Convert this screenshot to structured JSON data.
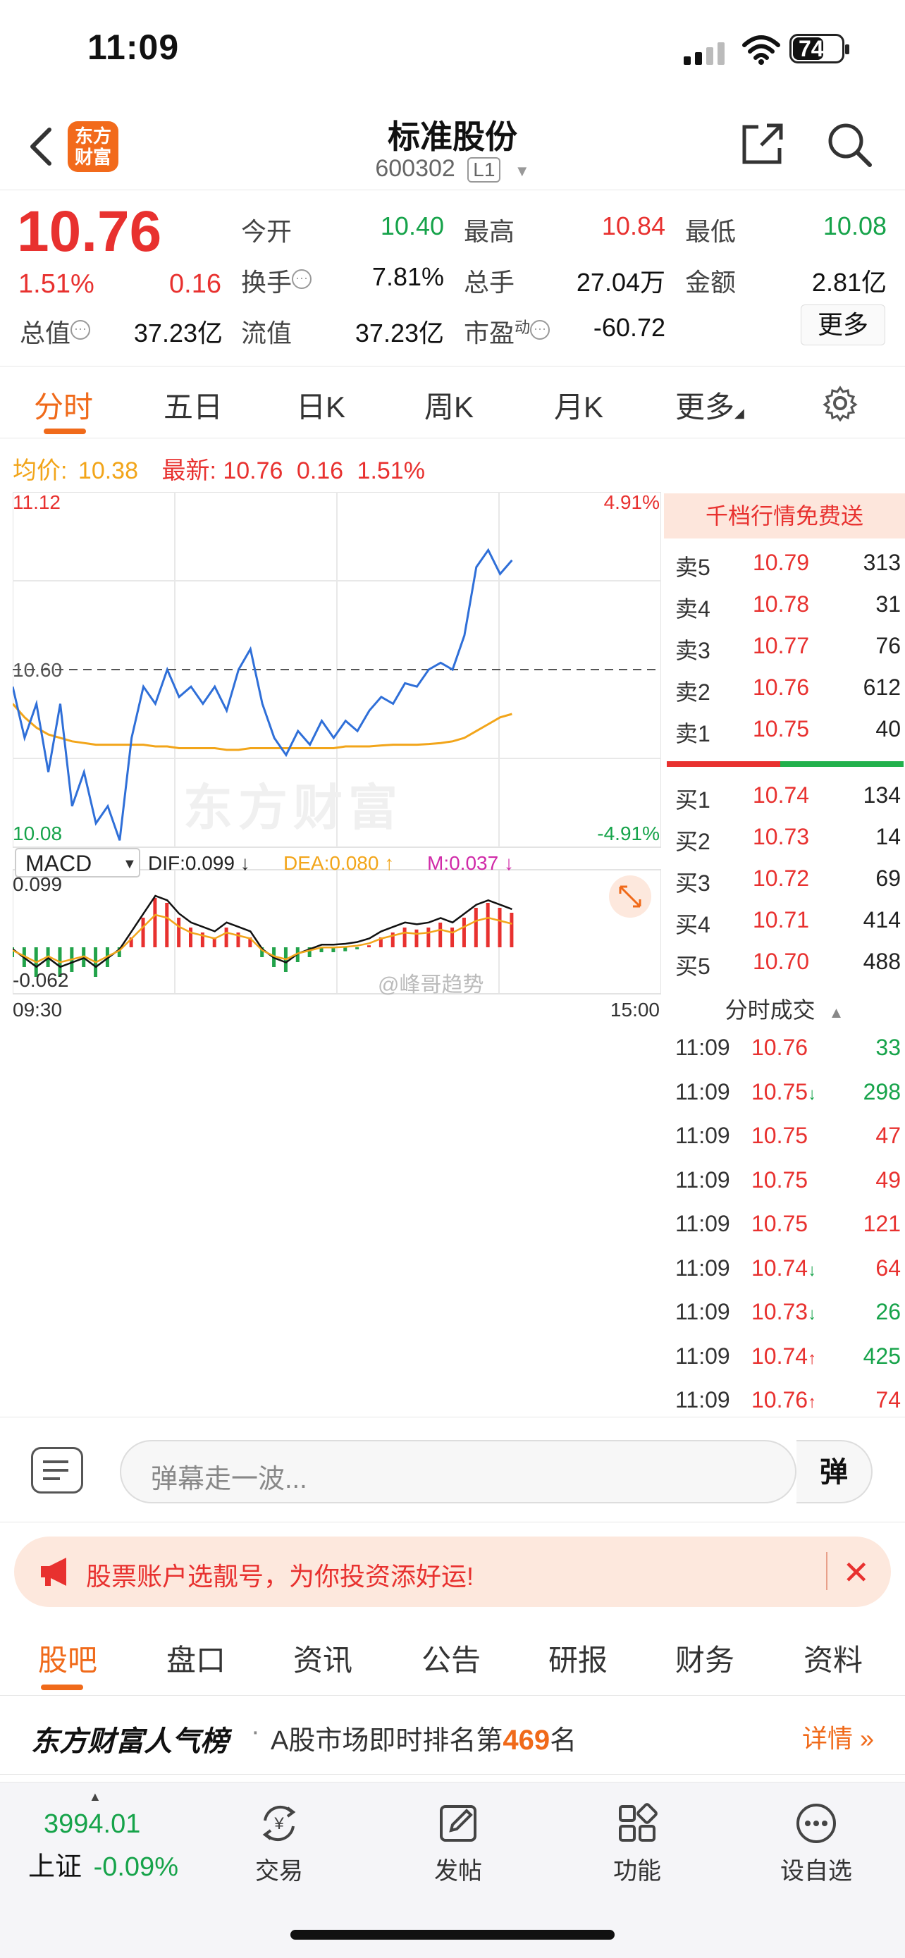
{
  "status": {
    "time": "11:09",
    "battery": "74"
  },
  "header": {
    "title": "标准股份",
    "code": "600302",
    "level": "L1",
    "logo_text": "东方\n财富"
  },
  "quote": {
    "price": "10.76",
    "pct": "1.51%",
    "chg": "0.16",
    "items": [
      {
        "label": "今开",
        "value": "10.40",
        "color": "#16a34a"
      },
      {
        "label": "最高",
        "value": "10.84",
        "color": "#e8312f"
      },
      {
        "label": "最低",
        "value": "10.08",
        "color": "#16a34a"
      },
      {
        "label": "换手",
        "value": "7.81%",
        "color": "#111"
      },
      {
        "label": "总手",
        "value": "27.04万",
        "color": "#111"
      },
      {
        "label": "金额",
        "value": "2.81亿",
        "color": "#111"
      },
      {
        "label": "总值",
        "value": "37.23亿",
        "color": "#111"
      },
      {
        "label": "流值",
        "value": "37.23亿",
        "color": "#111"
      },
      {
        "label": "市盈",
        "value": "-60.72",
        "color": "#111"
      }
    ],
    "dynamic_sup": "动",
    "more": "更多"
  },
  "tabs": [
    "分时",
    "五日",
    "日K",
    "周K",
    "月K",
    "更多"
  ],
  "avg": {
    "label": "均价:",
    "value": "10.38",
    "latest_label": "最新:",
    "latest": "10.76",
    "chg": "0.16",
    "pct": "1.51%"
  },
  "chart": {
    "ymax": "11.12",
    "ymid": "10.60",
    "ymin": "10.08",
    "pmax": "4.91%",
    "pmin": "-4.91%",
    "macd_label": "MACD",
    "dif": "DIF:0.099 ↓",
    "dea": "DEA:0.080 ↑",
    "m": "M:0.037 ↓",
    "macd_top": "0.099",
    "macd_bot": "-0.062",
    "t_start": "09:30",
    "t_end": "15:00",
    "watermark": "东方财富",
    "weibo": "@峰哥趋势"
  },
  "chart_data": {
    "type": "line",
    "price_axis": [
      10.08,
      11.12
    ],
    "price": [
      10.55,
      10.4,
      10.5,
      10.3,
      10.5,
      10.2,
      10.3,
      10.15,
      10.2,
      10.1,
      10.4,
      10.55,
      10.5,
      10.6,
      10.52,
      10.55,
      10.5,
      10.55,
      10.48,
      10.6,
      10.66,
      10.5,
      10.4,
      10.35,
      10.42,
      10.38,
      10.45,
      10.4,
      10.45,
      10.42,
      10.48,
      10.52,
      10.5,
      10.56,
      10.55,
      10.6,
      10.62,
      10.6,
      10.7,
      10.9,
      10.95,
      10.88,
      10.92
    ],
    "avg": [
      10.5,
      10.46,
      10.43,
      10.41,
      10.4,
      10.39,
      10.385,
      10.38,
      10.38,
      10.38,
      10.38,
      10.38,
      10.375,
      10.375,
      10.37,
      10.37,
      10.37,
      10.37,
      10.365,
      10.365,
      10.37,
      10.37,
      10.37,
      10.37,
      10.37,
      10.37,
      10.37,
      10.37,
      10.375,
      10.375,
      10.375,
      10.378,
      10.38,
      10.38,
      10.38,
      10.382,
      10.385,
      10.39,
      10.4,
      10.42,
      10.44,
      10.46,
      10.47
    ],
    "macd_bars": [
      -0.01,
      -0.02,
      -0.03,
      -0.02,
      -0.03,
      -0.025,
      -0.02,
      -0.03,
      -0.02,
      -0.01,
      0.01,
      0.03,
      0.05,
      0.045,
      0.03,
      0.02,
      0.015,
      0.01,
      0.02,
      0.015,
      0.01,
      -0.01,
      -0.02,
      -0.025,
      -0.015,
      -0.01,
      -0.005,
      -0.005,
      -0.004,
      -0.002,
      0.002,
      0.01,
      0.015,
      0.02,
      0.018,
      0.02,
      0.025,
      0.02,
      0.03,
      0.04,
      0.045,
      0.04,
      0.035
    ]
  },
  "orderbook": {
    "promo": "千档行情免费送",
    "asks": [
      {
        "label": "卖5",
        "price": "10.79",
        "vol": "313"
      },
      {
        "label": "卖4",
        "price": "10.78",
        "vol": "31"
      },
      {
        "label": "卖3",
        "price": "10.77",
        "vol": "76"
      },
      {
        "label": "卖2",
        "price": "10.76",
        "vol": "612"
      },
      {
        "label": "卖1",
        "price": "10.75",
        "vol": "40"
      }
    ],
    "bids": [
      {
        "label": "买1",
        "price": "10.74",
        "vol": "134"
      },
      {
        "label": "买2",
        "price": "10.73",
        "vol": "14"
      },
      {
        "label": "买3",
        "price": "10.72",
        "vol": "69"
      },
      {
        "label": "买4",
        "price": "10.71",
        "vol": "414"
      },
      {
        "label": "买5",
        "price": "10.70",
        "vol": "488"
      }
    ],
    "trades_title": "分时成交",
    "trades": [
      {
        "t": "11:09",
        "p": "10.76",
        "v": "33",
        "c": "#16a34a",
        "ar": ""
      },
      {
        "t": "11:09",
        "p": "10.75",
        "v": "298",
        "c": "#16a34a",
        "ar": "↓"
      },
      {
        "t": "11:09",
        "p": "10.75",
        "v": "47",
        "c": "#e8312f",
        "ar": ""
      },
      {
        "t": "11:09",
        "p": "10.75",
        "v": "49",
        "c": "#e8312f",
        "ar": ""
      },
      {
        "t": "11:09",
        "p": "10.75",
        "v": "121",
        "c": "#e8312f",
        "ar": ""
      },
      {
        "t": "11:09",
        "p": "10.74",
        "v": "64",
        "c": "#e8312f",
        "ar": "↓"
      },
      {
        "t": "11:09",
        "p": "10.73",
        "v": "26",
        "c": "#16a34a",
        "ar": "↓"
      },
      {
        "t": "11:09",
        "p": "10.74",
        "v": "425",
        "c": "#16a34a",
        "ar": "↑"
      },
      {
        "t": "11:09",
        "p": "10.76",
        "v": "74",
        "c": "#e8312f",
        "ar": "↑"
      }
    ]
  },
  "danmu": {
    "placeholder": "弹幕走一波...",
    "button": "弹"
  },
  "banner": {
    "text": "股票账户选靓号，为你投资添好运!"
  },
  "bottom_tabs": [
    "股吧",
    "盘口",
    "资讯",
    "公告",
    "研报",
    "财务",
    "资料"
  ],
  "popularity": {
    "brand": "东方财富人气榜",
    "dot": "·",
    "desc": "A股市场即时排名第",
    "rank": "469",
    "unit": "名",
    "detail": "详情"
  },
  "nav": {
    "index_value": "3994.01",
    "index_name": "上证",
    "index_chg": "-0.09%",
    "items": [
      "交易",
      "发帖",
      "功能",
      "设自选"
    ]
  }
}
